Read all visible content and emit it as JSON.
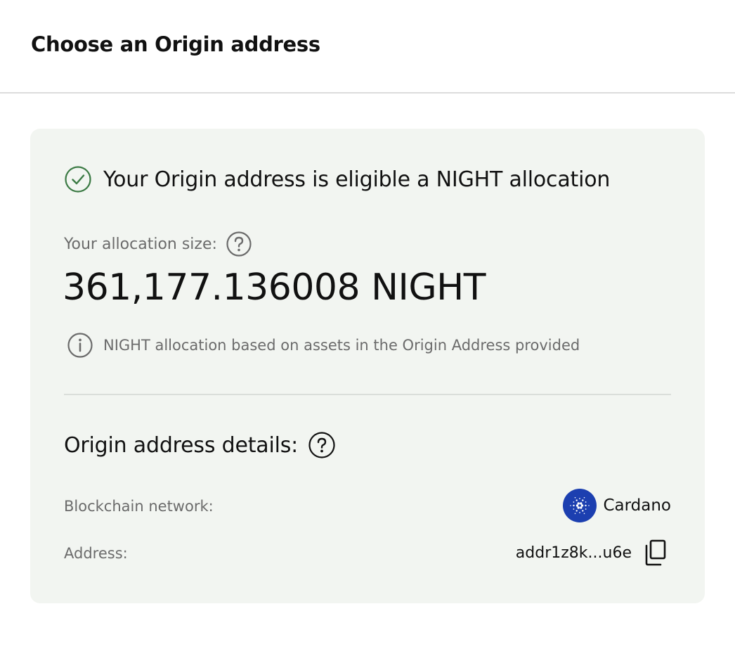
{
  "header": {
    "title": "Choose an Origin address"
  },
  "eligibility": {
    "message": "Your Origin address is eligible a NIGHT allocation"
  },
  "allocation": {
    "label": "Your allocation size:",
    "value": "361,177.136008 NIGHT",
    "note": "NIGHT allocation based on assets in the Origin Address provided"
  },
  "details": {
    "title": "Origin address details:",
    "network_label": "Blockchain network:",
    "network_value": "Cardano",
    "address_label": "Address:",
    "address_value": "addr1z8k...u6e"
  },
  "colors": {
    "card_bg": "#f2f5f1",
    "success_green": "#3b7a44",
    "cardano_blue": "#1c3fb0"
  },
  "icons": [
    "check-circle-icon",
    "help-icon",
    "info-icon",
    "cardano-icon",
    "copy-icon"
  ]
}
